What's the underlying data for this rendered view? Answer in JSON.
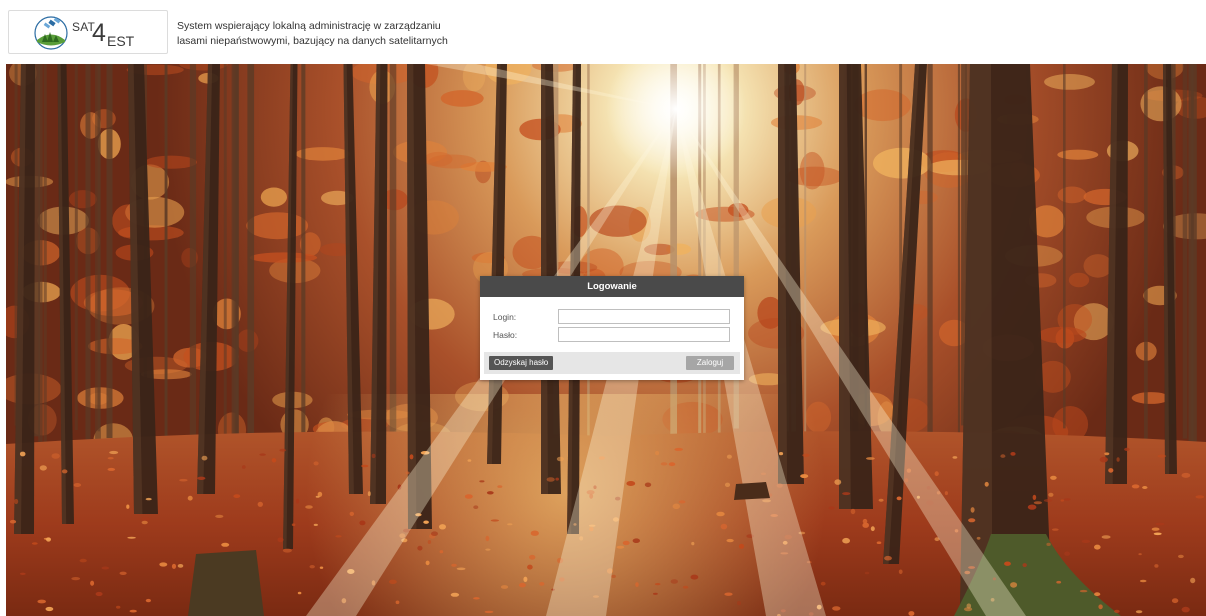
{
  "header": {
    "logo": {
      "sat": "SAT",
      "four": "4",
      "est": "EST"
    },
    "tagline_line1": "System wspierający lokalną administrację w zarządzaniu",
    "tagline_line2": "lasami niepaństwowymi, bazujący na danych satelitarnych"
  },
  "login": {
    "title": "Logowanie",
    "login_label": "Login:",
    "login_value": "",
    "password_label": "Hasło:",
    "password_value": "",
    "recover_button": "Odzyskaj hasło",
    "submit_button": "Zaloguj"
  },
  "colors": {
    "dialog_header": "#4a4a4a",
    "recover_button": "#555555",
    "submit_button": "#a6a6a6",
    "logo_green": "#5a9e3a",
    "logo_blue": "#2b6ca3"
  },
  "background": {
    "scene": "autumn-forest-with-sunbeams"
  }
}
